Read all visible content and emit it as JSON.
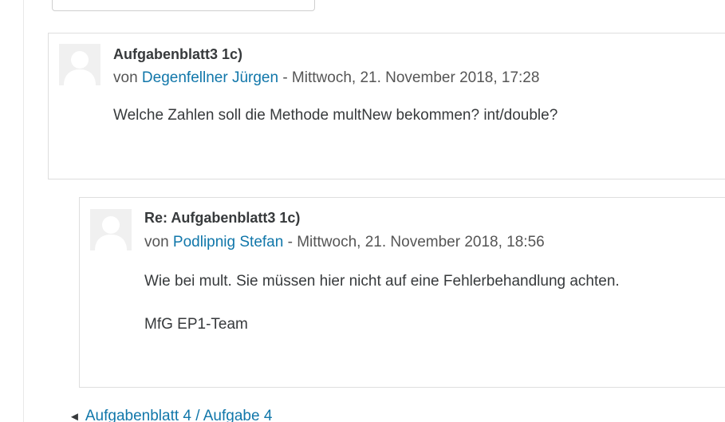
{
  "posts": [
    {
      "subject": "Aufgabenblatt3 1c)",
      "by_prefix": "von",
      "author": "Degenfellner Jürgen",
      "date": "- Mittwoch, 21. November 2018, 17:28",
      "content": [
        "Welche Zahlen soll die Methode multNew bekommen? int/double?"
      ]
    },
    {
      "subject": "Re: Aufgabenblatt3 1c)",
      "by_prefix": "von",
      "author": "Podlipnig Stefan",
      "date": "- Mittwoch, 21. November 2018, 18:56",
      "content": [
        "Wie bei mult. Sie müssen hier nicht auf eine Fehlerbehandlung achten.",
        "MfG EP1-Team"
      ]
    }
  ],
  "navigation": {
    "prev_arrow": "◄",
    "prev_label": "Aufgabenblatt 4 / Aufgabe 4"
  },
  "icons": {
    "avatar": "user-placeholder-icon",
    "prev": "left-triangle-arrow-icon"
  },
  "colors": {
    "link": "#1177aa",
    "text": "#373a3c",
    "border": "#dedede",
    "avatar_bg": "#f0f0f0"
  }
}
